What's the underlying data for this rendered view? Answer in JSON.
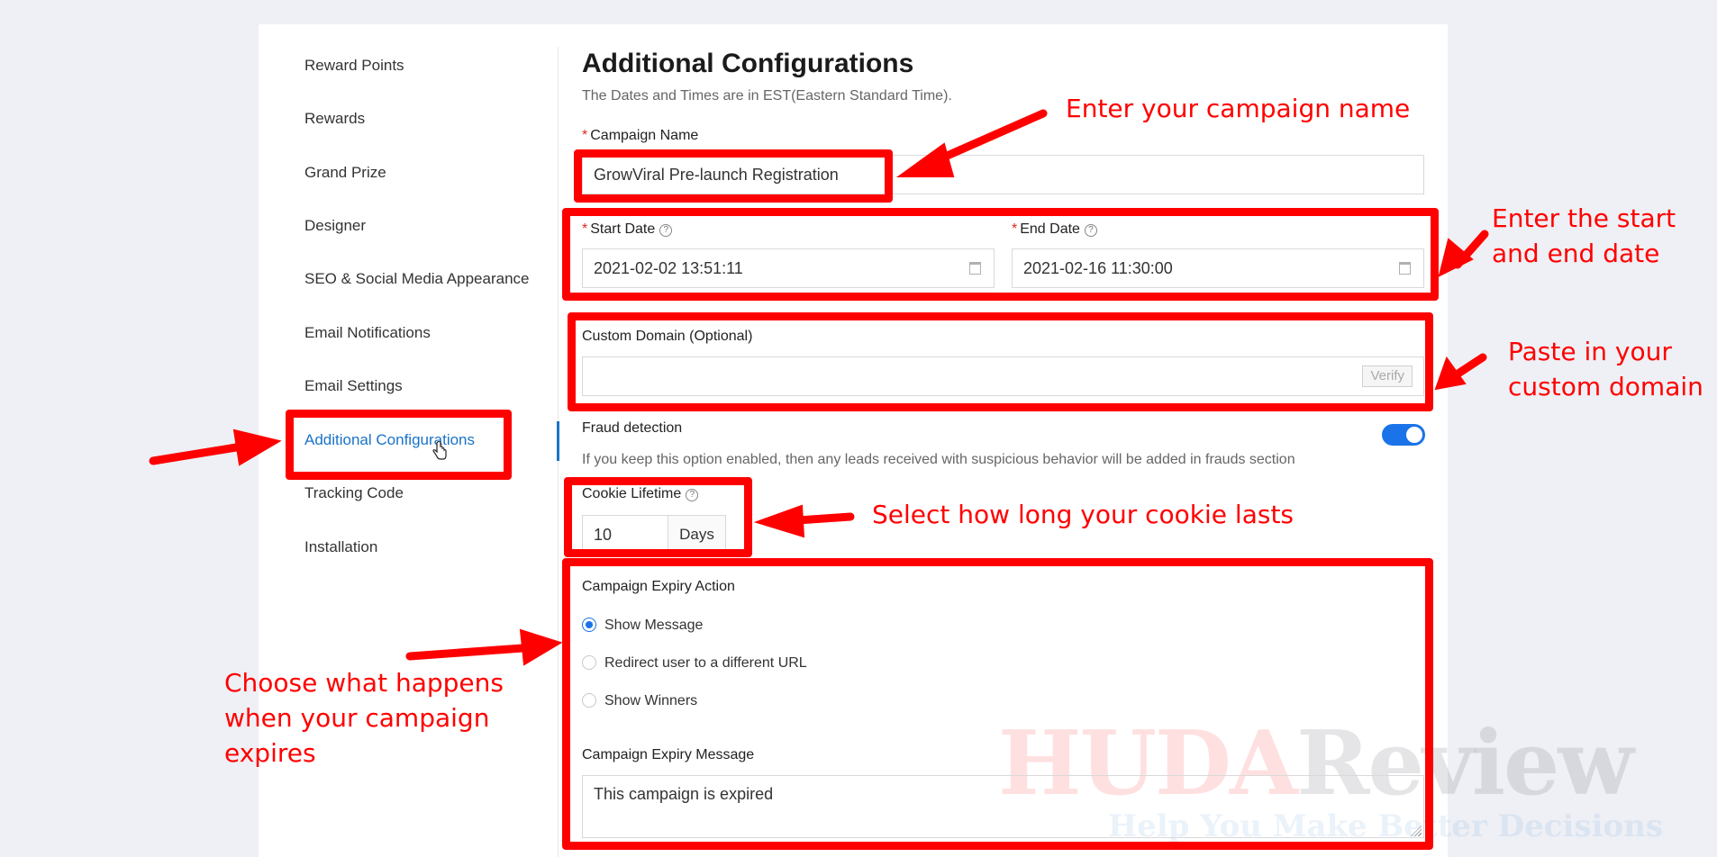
{
  "sidebar": {
    "items": [
      {
        "label": "Reward Points"
      },
      {
        "label": "Rewards"
      },
      {
        "label": "Grand Prize"
      },
      {
        "label": "Designer"
      },
      {
        "label": "SEO & Social Media Appearance"
      },
      {
        "label": "Email Notifications"
      },
      {
        "label": "Email Settings"
      },
      {
        "label": "Additional Configurations",
        "active": true
      },
      {
        "label": "Tracking Code"
      },
      {
        "label": "Installation"
      }
    ]
  },
  "main": {
    "title": "Additional Configurations",
    "subtitle": "The Dates and Times are in EST(Eastern Standard Time).",
    "campaign_name": {
      "label": "Campaign Name",
      "value": "GrowViral Pre-launch Registration"
    },
    "start_date": {
      "label": "Start Date",
      "value": "2021-02-02 13:51:11"
    },
    "end_date": {
      "label": "End Date",
      "value": "2021-02-16 11:30:00"
    },
    "custom_domain": {
      "label": "Custom Domain (Optional)",
      "value": "",
      "verify_label": "Verify"
    },
    "fraud_detection": {
      "label": "Fraud detection",
      "enabled": true,
      "hint": "If you keep this option enabled, then any leads received with suspicious behavior will be added in frauds section"
    },
    "cookie_lifetime": {
      "label": "Cookie Lifetime",
      "value": "10",
      "unit": "Days"
    },
    "expiry_action": {
      "label": "Campaign Expiry Action",
      "options": [
        {
          "label": "Show Message",
          "checked": true
        },
        {
          "label": "Redirect user to a different URL",
          "checked": false
        },
        {
          "label": "Show Winners",
          "checked": false
        }
      ]
    },
    "expiry_message": {
      "label": "Campaign Expiry Message",
      "value": "This campaign is expired"
    }
  },
  "annotations": {
    "campaign_name": "Enter your campaign name",
    "dates_line1": "Enter the start",
    "dates_line2": "and end date",
    "domain_line1": "Paste in your",
    "domain_line2": "custom domain",
    "cookie": "Select how long your cookie lasts",
    "expiry_line1": "Choose what happens",
    "expiry_line2": "when your campaign",
    "expiry_line3": "expires",
    "color": "#ff0000"
  },
  "watermark": {
    "brand_part1": "HUDA",
    "brand_part2": "Review",
    "tagline": "Help You Make Better Decisions"
  },
  "colors": {
    "accent": "#1a73e8",
    "active_nav": "#1a73c8",
    "background": "#eef0f5"
  }
}
